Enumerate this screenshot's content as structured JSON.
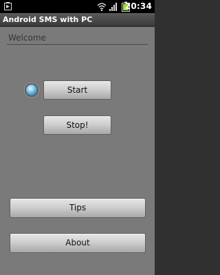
{
  "status_bar": {
    "time": "20:34",
    "icons": [
      "notification-icon",
      "wifi-icon",
      "signal-icon",
      "battery-icon"
    ],
    "battery_color": "#9fe03a"
  },
  "app": {
    "title": "Android SMS with PC"
  },
  "main": {
    "welcome": "Welcome",
    "start_label": "Start",
    "stop_label": "Stop!",
    "tips_label": "Tips",
    "about_label": "About"
  }
}
